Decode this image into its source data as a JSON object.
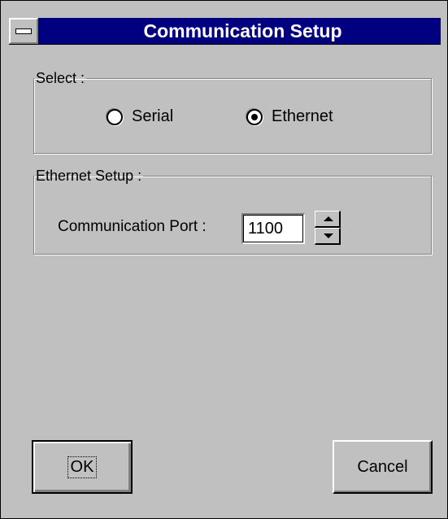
{
  "window": {
    "title": "Communication Setup"
  },
  "select_group": {
    "legend": "Select :",
    "options": [
      {
        "label": "Serial",
        "selected": false
      },
      {
        "label": "Ethernet",
        "selected": true
      }
    ]
  },
  "ethernet_setup": {
    "legend": "Ethernet Setup :",
    "port_label": "Communication Port :",
    "port_value": "1100"
  },
  "buttons": {
    "ok_label": "OK",
    "cancel_label": "Cancel"
  },
  "colors": {
    "titlebar": "#000080",
    "face": "#c0c0c0"
  }
}
